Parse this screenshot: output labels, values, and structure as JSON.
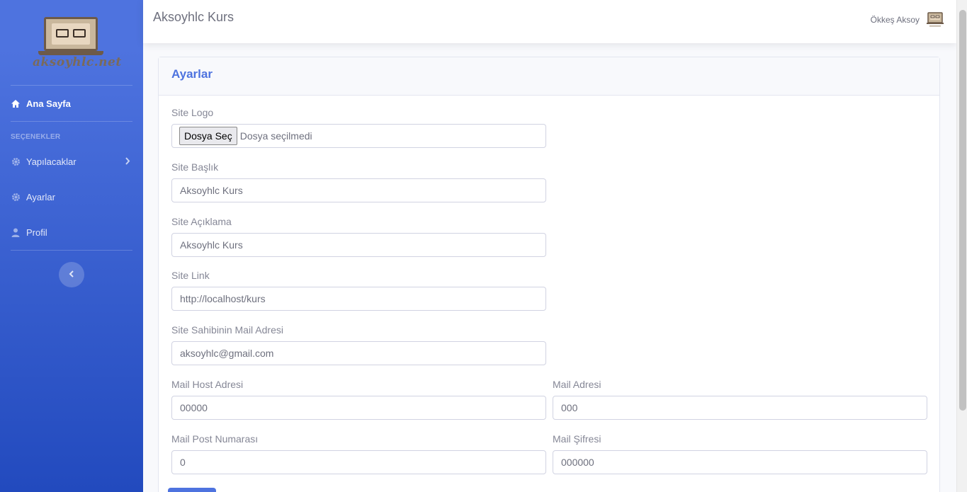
{
  "sidebar": {
    "logo_text": "aksoyhlc.net",
    "items": [
      {
        "label": "Ana Sayfa",
        "icon": "home-icon"
      },
      {
        "label": "Yapılacaklar",
        "icon": "cog-icon"
      },
      {
        "label": "Ayarlar",
        "icon": "cog-icon"
      },
      {
        "label": "Profil",
        "icon": "user-icon"
      }
    ],
    "heading": "SEÇENEKLER"
  },
  "topbar": {
    "title": "Aksoyhlc Kurs",
    "user_name": "Ökkeş Aksoy"
  },
  "card": {
    "title": "Ayarlar"
  },
  "form": {
    "logo": {
      "label": "Site Logo",
      "button": "Dosya Seç",
      "status": "Dosya seçilmedi"
    },
    "baslik": {
      "label": "Site Başlık",
      "value": "Aksoyhlc Kurs"
    },
    "aciklama": {
      "label": "Site Açıklama",
      "value": "Aksoyhlc Kurs"
    },
    "link": {
      "label": "Site Link",
      "value": "http://localhost/kurs"
    },
    "mail": {
      "label": "Site Sahibinin Mail Adresi",
      "value": "aksoyhlc@gmail.com"
    },
    "mail_host": {
      "label": "Mail Host Adresi",
      "value": "00000"
    },
    "mail_adres": {
      "label": "Mail Adresi",
      "value": "000"
    },
    "mail_port": {
      "label": "Mail Post Numarası",
      "value": "0"
    },
    "mail_sifre": {
      "label": "Mail Şifresi",
      "value": "000000"
    }
  },
  "colors": {
    "primary": "#4e73df",
    "primary_dark": "#224abe",
    "text": "#858796"
  }
}
